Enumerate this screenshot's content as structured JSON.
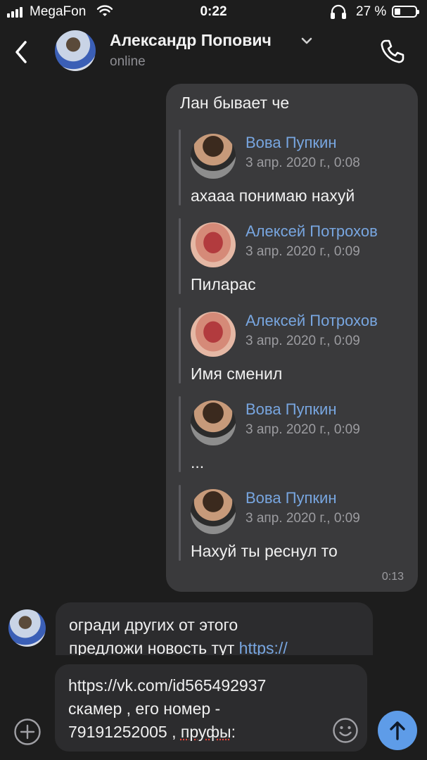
{
  "status_bar": {
    "carrier": "MegaFon",
    "time": "0:22",
    "battery_percent": "27 %",
    "battery_level": 0.27,
    "icons": [
      "signal-icon",
      "wifi-icon",
      "headphones-icon",
      "battery-icon"
    ]
  },
  "header": {
    "contact_name": "Александр Попович",
    "status": "online",
    "icons": [
      "back-icon",
      "chevron-down-icon",
      "phone-icon"
    ]
  },
  "outgoing": {
    "text": "Лан бывает че",
    "time": "0:13",
    "forwarded": [
      {
        "name": "Вова Пупкин",
        "date": "3 апр. 2020 г., 0:08",
        "text": "ахааа понимаю нахуй",
        "avatar": "face"
      },
      {
        "name": "Алексей Потрохов",
        "date": "3 апр. 2020 г., 0:09",
        "text": "Пиларас",
        "avatar": "lips"
      },
      {
        "name": "Алексей Потрохов",
        "date": "3 апр. 2020 г., 0:09",
        "text": "Имя сменил",
        "avatar": "lips"
      },
      {
        "name": "Вова Пупкин",
        "date": "3 апр. 2020 г., 0:09",
        "text": "...",
        "avatar": "face"
      },
      {
        "name": "Вова Пупкин",
        "date": "3 апр. 2020 г., 0:09",
        "text": "Нахуй ты реснул то",
        "avatar": "face"
      }
    ]
  },
  "incoming": {
    "line1": "огради других от этого",
    "line2_text": "предложи новость тут ",
    "line2_link": "https://"
  },
  "composer": {
    "line1": "https://vk.com/id565492937",
    "line2": "скамер , его номер -",
    "line3_prefix": "79191252005 , ",
    "line3_typo": "пруфы",
    "line3_suffix": ":",
    "icons": [
      "plus-icon",
      "emoji-icon",
      "send-arrow-icon"
    ]
  },
  "colors": {
    "background": "#1d1d1d",
    "bubble_out": "#3a3a3c",
    "bubble_in": "#2c2c2e",
    "accent": "#78a6e0",
    "send_button": "#5e9ce8"
  }
}
